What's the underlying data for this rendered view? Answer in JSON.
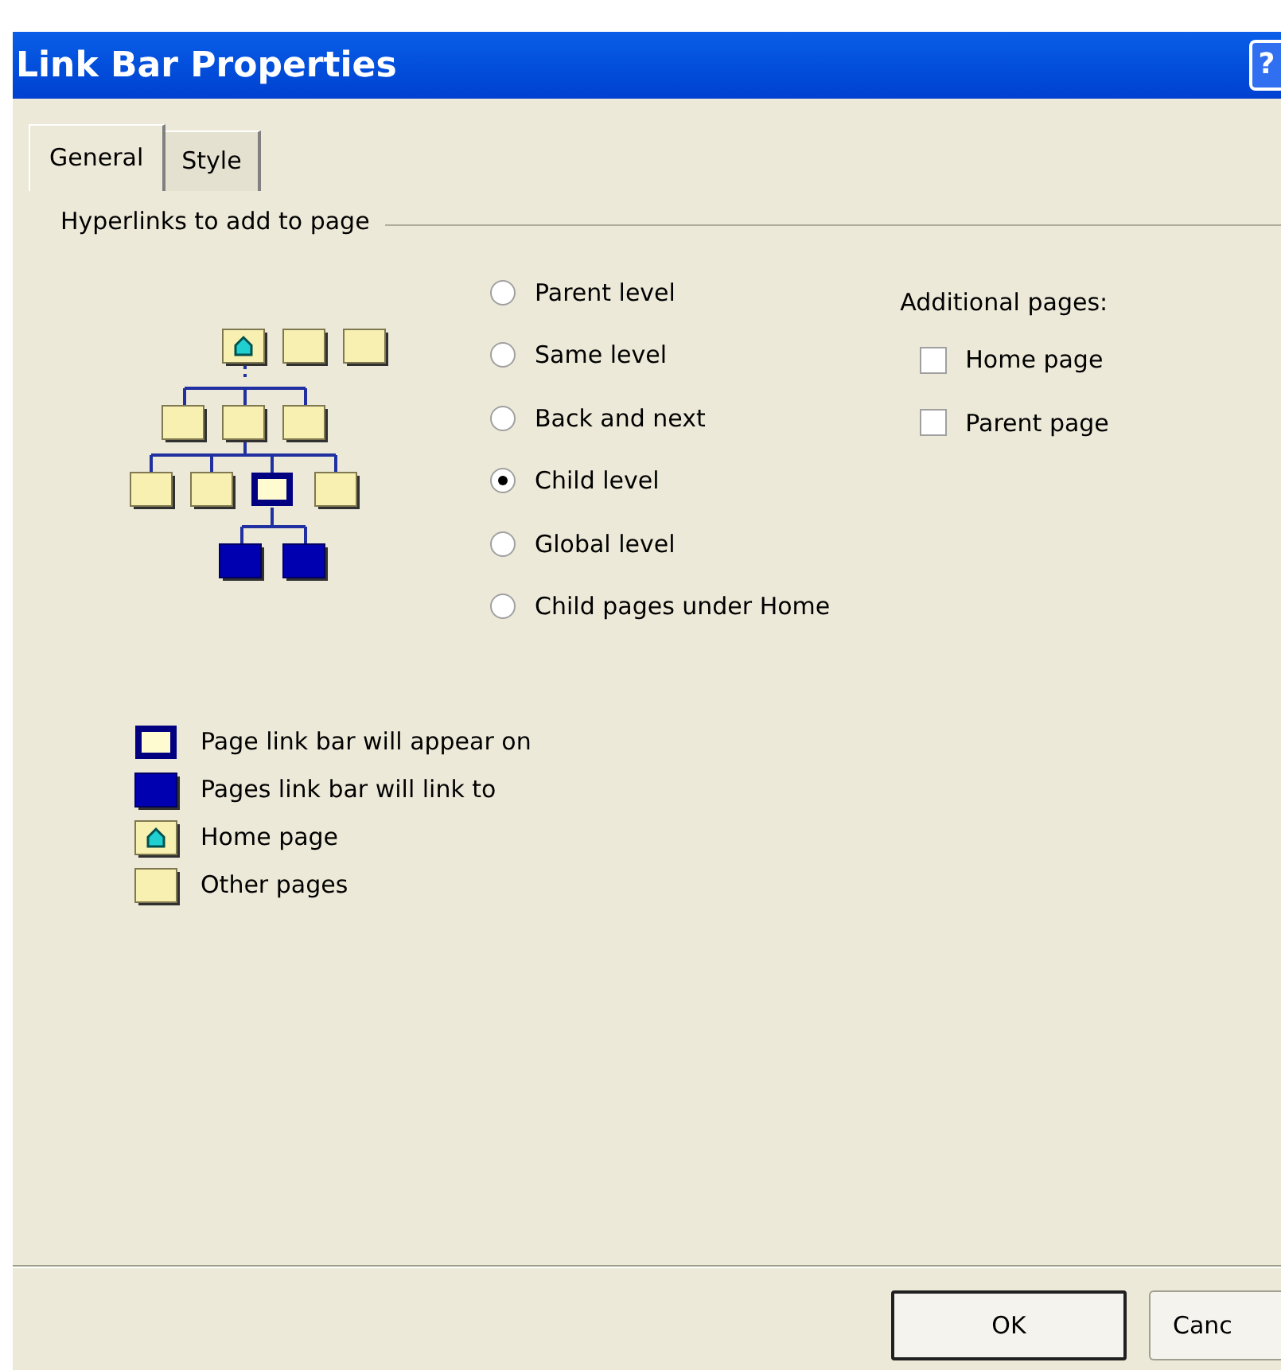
{
  "window": {
    "title": "Link Bar Properties",
    "help": "?"
  },
  "tabs": [
    {
      "label": "General",
      "selected": true
    },
    {
      "label": "Style",
      "selected": false
    }
  ],
  "group": {
    "title": "Hyperlinks to add to page"
  },
  "options": [
    {
      "label": "Parent level",
      "selected": false
    },
    {
      "label": "Same level",
      "selected": false
    },
    {
      "label": "Back and next",
      "selected": false
    },
    {
      "label": "Child level",
      "selected": true
    },
    {
      "label": "Global level",
      "selected": false
    },
    {
      "label": "Child pages under Home",
      "selected": false
    }
  ],
  "additional": {
    "title": "Additional pages:",
    "items": [
      {
        "label": "Home page",
        "checked": false
      },
      {
        "label": "Parent page",
        "checked": false
      }
    ]
  },
  "legend": [
    {
      "kind": "current",
      "label": "Page link bar will appear on"
    },
    {
      "kind": "target",
      "label": "Pages link bar will link to"
    },
    {
      "kind": "home",
      "label": "Home page"
    },
    {
      "kind": "other",
      "label": "Other pages"
    }
  ],
  "buttons": [
    "OK",
    "Canc"
  ]
}
